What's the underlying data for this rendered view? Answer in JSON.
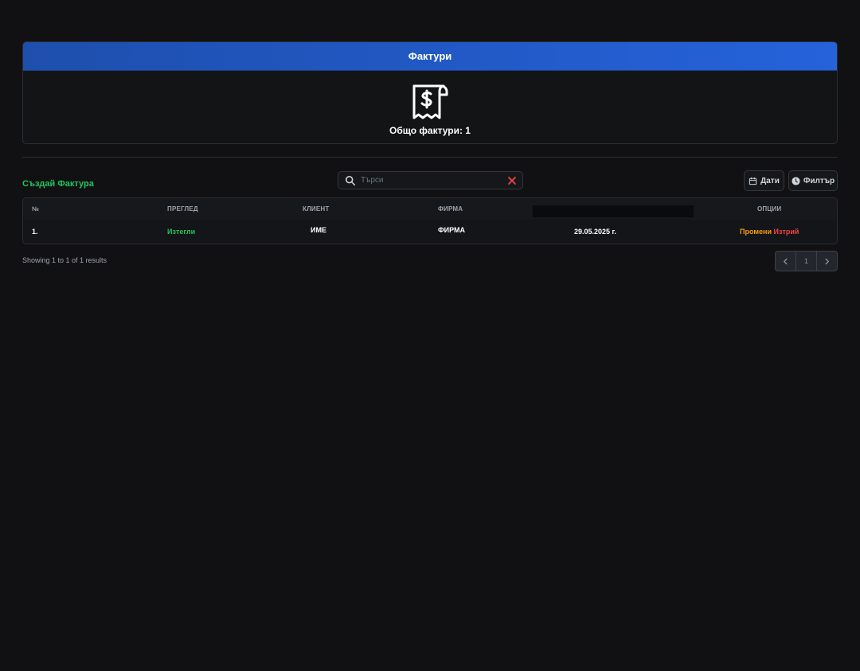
{
  "header": {
    "title": "Фактури"
  },
  "summary": {
    "icon": "receipt-dollar-icon",
    "total_label": "Общо фактури: 1"
  },
  "toolbar": {
    "create_label": "Създай Фактура",
    "search_placeholder": "Търси",
    "search_value": "",
    "dates_label": "Дати",
    "filter_label": "Филтър"
  },
  "table": {
    "columns": [
      "№",
      "ПРЕГЛЕД",
      "КЛИЕНТ",
      "ФИРМА",
      "",
      "ОПЦИИ"
    ],
    "rows": [
      {
        "num": "1.",
        "view": "Изтегли",
        "client": "ИМЕ",
        "company": "ФИРМА",
        "date": "29.05.2025 г.",
        "edit": "Промени",
        "delete": "Изтрий"
      }
    ]
  },
  "pagination": {
    "summary": "Showing 1 to 1 of 1 results",
    "current_page": "1"
  },
  "colors": {
    "background": "#111113",
    "header_blue": "#2563db",
    "accent_green": "#22c55e",
    "edit_amber": "#f59e0b",
    "delete_red": "#ef4444"
  }
}
